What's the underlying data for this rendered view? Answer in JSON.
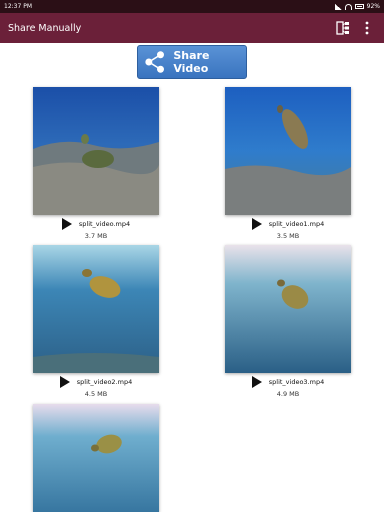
{
  "status_bar": {
    "time": "12:37 PM",
    "battery": "92%"
  },
  "app_bar": {
    "title": "Share Manually"
  },
  "share_button": {
    "label": "Share Video"
  },
  "videos": [
    {
      "name": "split_video.mp4",
      "size": "3.7 MB"
    },
    {
      "name": "split_video1.mp4",
      "size": "3.5 MB"
    },
    {
      "name": "split_video2.mp4",
      "size": "4.5 MB"
    },
    {
      "name": "split_video3.mp4",
      "size": "4.9 MB"
    },
    {
      "name": "",
      "size": ""
    }
  ],
  "colors": {
    "app_bar": "#6b2039",
    "status_bar": "#2b0f16",
    "button": "#4a84cc"
  }
}
